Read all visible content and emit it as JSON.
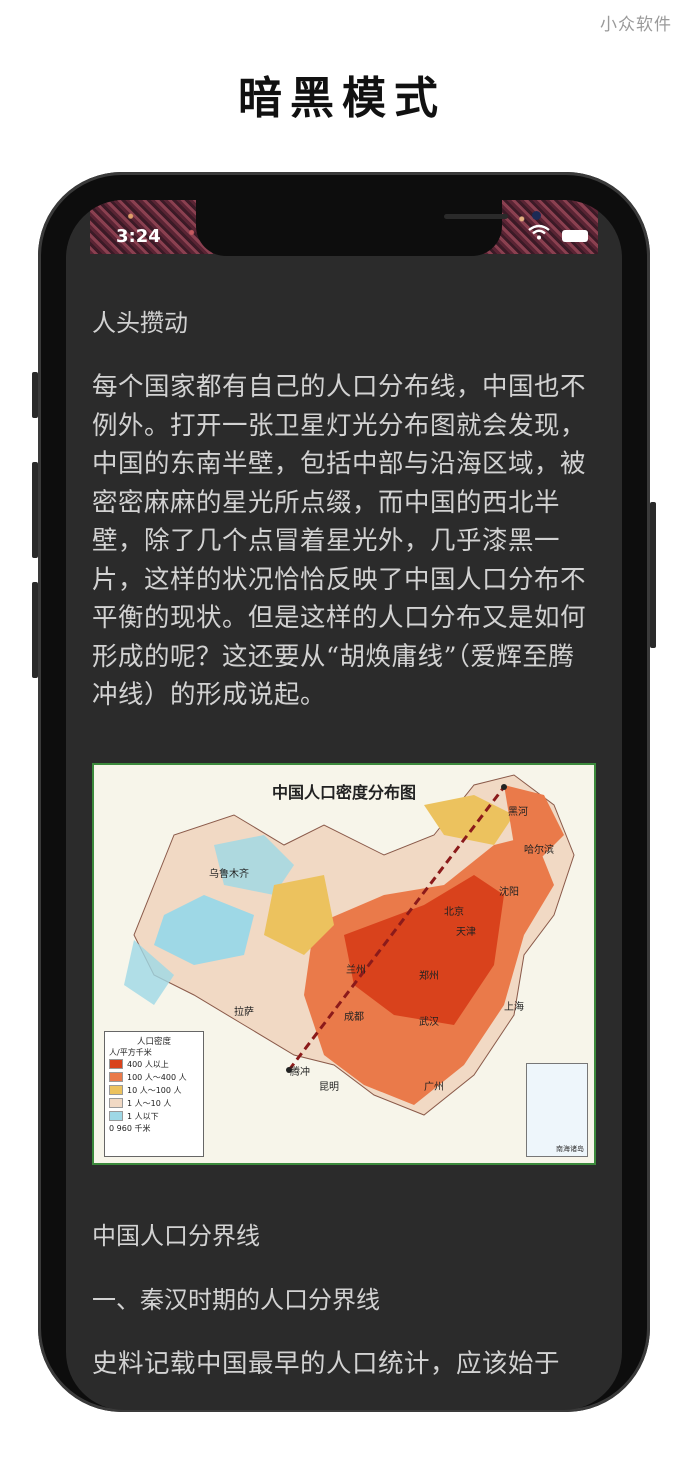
{
  "watermark": "小众软件",
  "promo_title": "暗黑模式",
  "status": {
    "time": "3:24",
    "wifi_icon": "wifi-icon",
    "battery_icon": "battery-icon"
  },
  "article": {
    "section_label": "人头攒动",
    "paragraph1": "每个国家都有自己的人口分布线，中国也不例外。打开一张卫星灯光分布图就会发现，中国的东南半壁，包括中部与沿海区域，被密密麻麻的星光所点缀，而中国的西北半壁，除了几个点冒着星光外，几乎漆黑一片，这样的状况恰恰反映了中国人口分布不平衡的现状。但是这样的人口分布又是如何形成的呢？这还要从“胡焕庸线”（爱辉至腾冲线）的形成说起。",
    "map": {
      "title": "中国人口密度分布图",
      "cities": [
        "黑河",
        "哈尔滨",
        "沈阳",
        "北京",
        "天津",
        "乌鲁木齐",
        "兰州",
        "郑州",
        "上海",
        "拉萨",
        "成都",
        "武汉",
        "腾冲",
        "昆明",
        "广州"
      ],
      "legend_title": "人口密度",
      "legend_unit": "人/平方千米",
      "legend_items": [
        "400 人以上",
        "100 人～400 人",
        "10 人～100 人",
        "1 人～10 人",
        "1 人以下"
      ],
      "scale": "0    960 千米",
      "inset_label": "南海诸岛",
      "colors": [
        "#d9421c",
        "#ea7a4a",
        "#ecc25e",
        "#f1d9c4",
        "#9ed8e6"
      ]
    },
    "heading1": "中国人口分界线",
    "heading2": "一、秦汉时期的人口分界线",
    "paragraph2": "史料记载中国最早的人口统计，应该始于"
  }
}
